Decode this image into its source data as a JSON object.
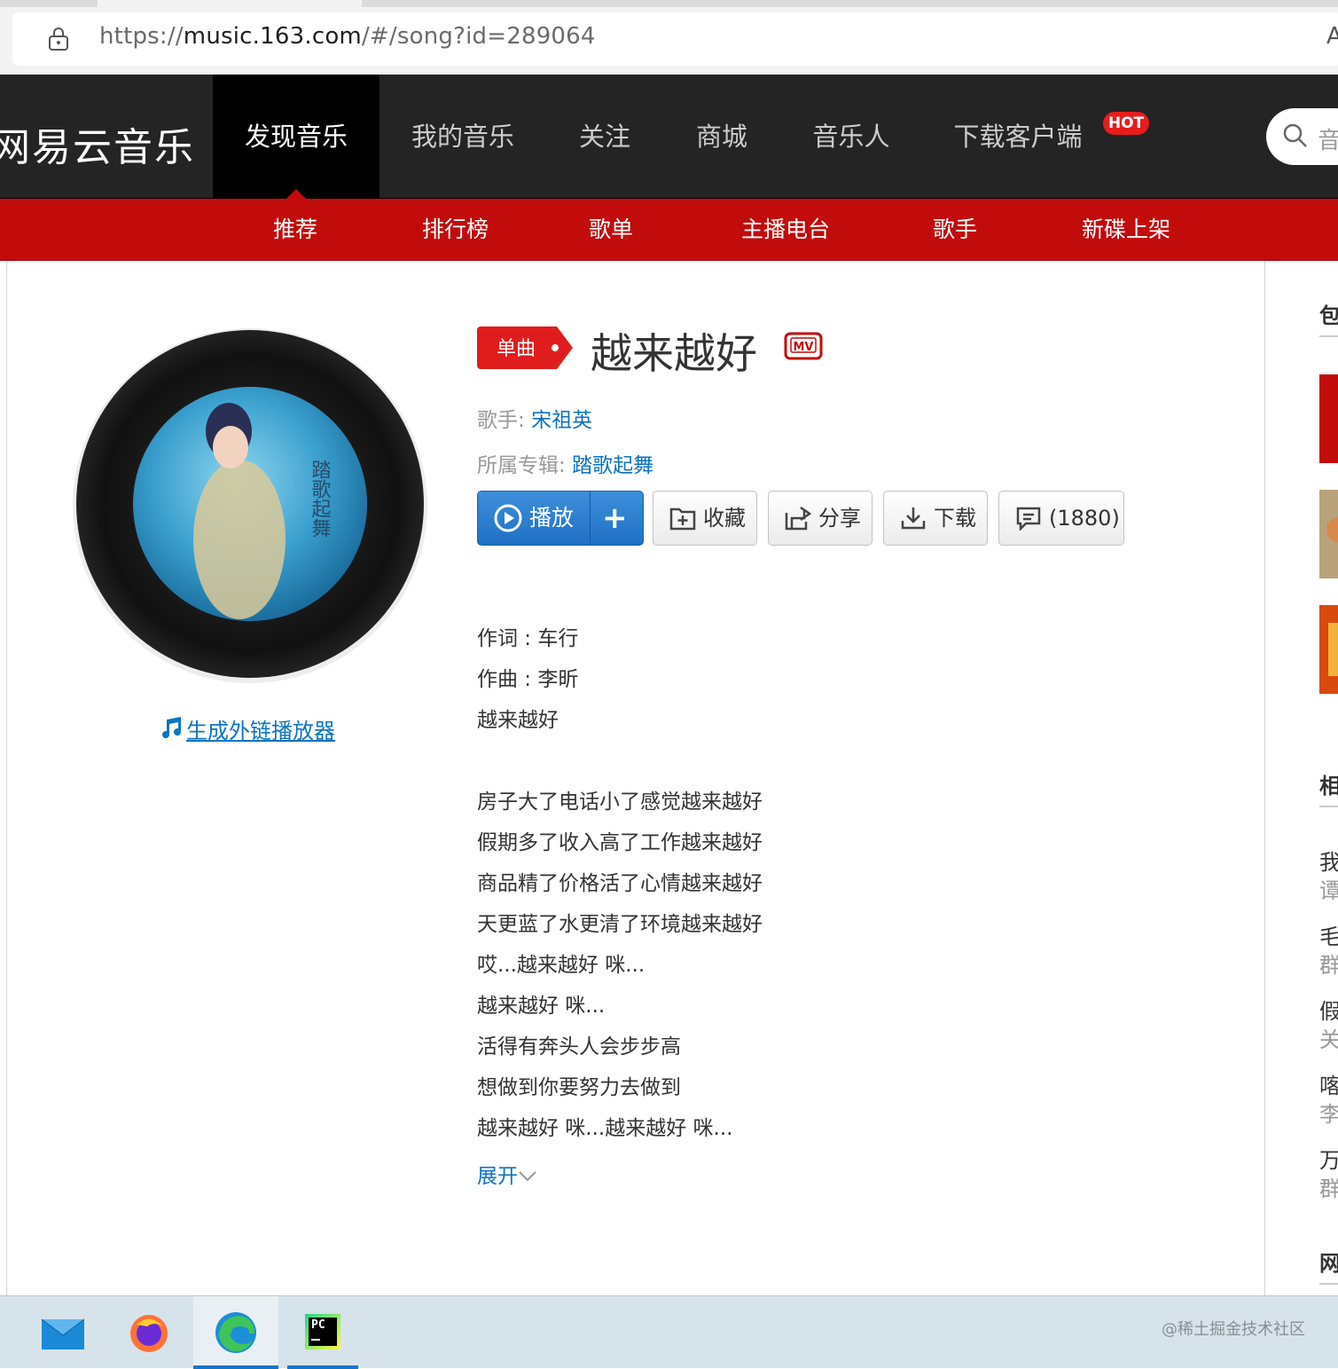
{
  "browser": {
    "url_prefix": "https://",
    "url_host": "music.163.com",
    "url_path": "/#/song?id=289064",
    "reader_glyph": "A"
  },
  "topnav": {
    "logo": "网易云音乐",
    "items": [
      "发现音乐",
      "我的音乐",
      "关注",
      "商城",
      "音乐人",
      "下载客户端"
    ],
    "active_index": 0,
    "hot_badge": "HOT",
    "search_placeholder": "音"
  },
  "subnav": {
    "items": [
      "推荐",
      "排行榜",
      "歌单",
      "主播电台",
      "歌手",
      "新碟上架"
    ]
  },
  "song": {
    "type_badge": "单曲",
    "title": "越来越好",
    "mv_badge": "MV",
    "artist_label": "歌手:",
    "artist": "宋祖英",
    "album_label": "所属专辑:",
    "album": "踏歌起舞",
    "ext_player_link": "生成外链播放器"
  },
  "actions": {
    "play": "播放",
    "add": "+",
    "collect": "收藏",
    "share": "分享",
    "download": "下载",
    "comment": "(1880)"
  },
  "lyrics": {
    "credits": [
      "作词 : 车行",
      "作曲 : 李昕",
      "越来越好"
    ],
    "lines": [
      "房子大了电话小了感觉越来越好",
      "假期多了收入高了工作越来越好",
      "商品精了价格活了心情越来越好",
      "天更蓝了水更清了环境越来越好",
      "哎...越来越好 咪...",
      "越来越好 咪...",
      "活得有奔头人会步步高",
      "想做到你要努力去做到",
      "越来越好 咪...越来越好 咪..."
    ],
    "expand": "展开"
  },
  "sidebar": {
    "section1_title": "包",
    "section2_title": "相",
    "section3_title": "网",
    "related": [
      {
        "title": "我",
        "sub": "谭"
      },
      {
        "title": "毛",
        "sub": "群"
      },
      {
        "title": "假",
        "sub": "关"
      },
      {
        "title": "喀",
        "sub": "李"
      },
      {
        "title": "万",
        "sub": "群"
      }
    ]
  },
  "taskbar": {
    "apps": [
      "mail-icon",
      "firefox-icon",
      "edge-icon",
      "pycharm-icon"
    ],
    "pycharm_label": "PC",
    "watermark": "@稀土掘金技术社区"
  },
  "colors": {
    "brand_red": "#c20c0c",
    "link_blue": "#0c73c2",
    "nav_bg": "#242424"
  }
}
